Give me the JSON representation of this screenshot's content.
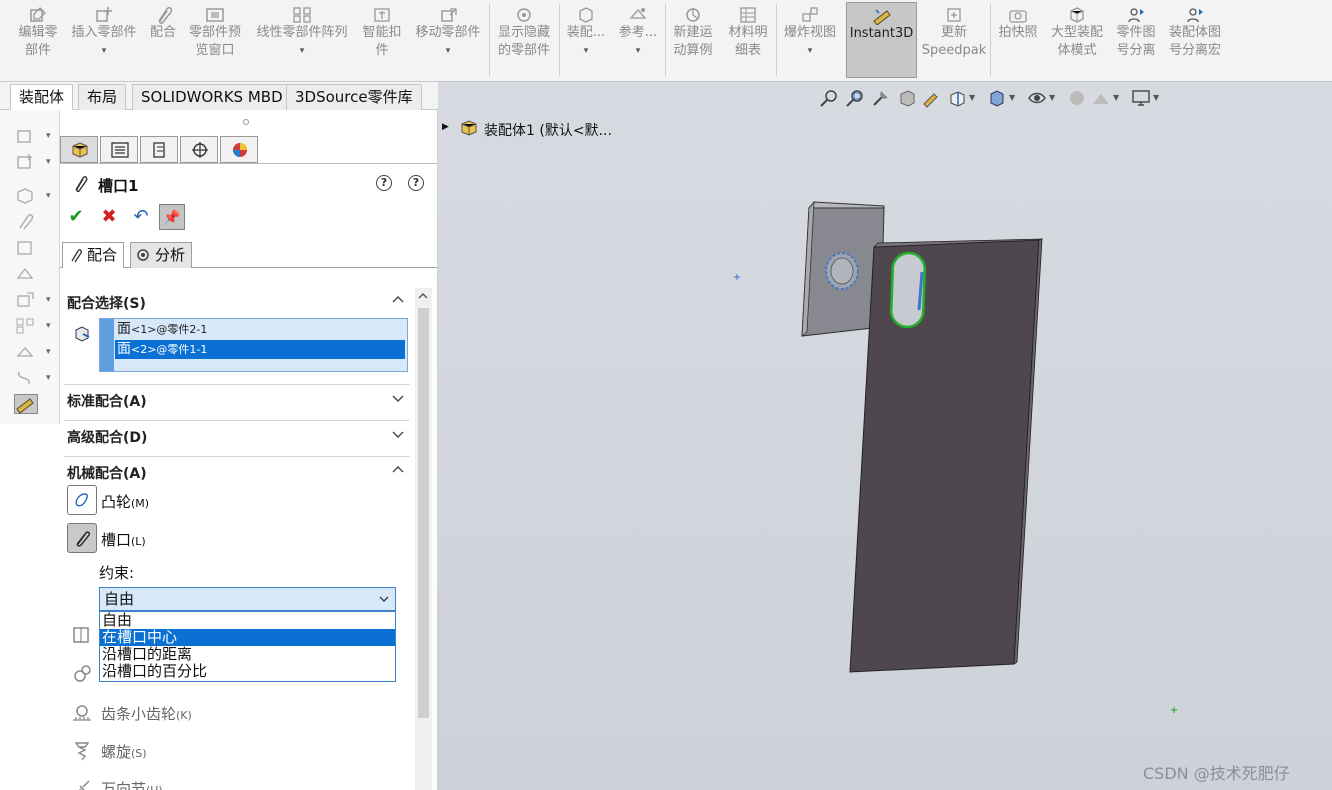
{
  "ribbon": {
    "buttons": [
      {
        "label": "编辑零\n部件",
        "icon": "edit-component-icon"
      },
      {
        "label": "插入零部件",
        "icon": "insert-component-icon"
      },
      {
        "label": "配合",
        "icon": "mate-icon"
      },
      {
        "label": "零部件预\n览窗口",
        "icon": "component-preview-icon"
      },
      {
        "label": "线性零部件阵列",
        "icon": "linear-pattern-icon"
      },
      {
        "label": "智能扣\n件",
        "icon": "smart-fasteners-icon"
      },
      {
        "label": "移动零部件",
        "icon": "move-component-icon"
      },
      {
        "label": "显示隐藏\n的零部件",
        "icon": "show-hidden-icon"
      },
      {
        "label": "装配...",
        "icon": "assembly-features-icon"
      },
      {
        "label": "参考...",
        "icon": "reference-geometry-icon"
      },
      {
        "label": "新建运\n动算例",
        "icon": "new-motion-study-icon"
      },
      {
        "label": "材料明\n细表",
        "icon": "bom-icon"
      },
      {
        "label": "爆炸视图",
        "icon": "exploded-view-icon"
      },
      {
        "label": "Instant3D",
        "icon": "instant3d-icon"
      },
      {
        "label": "更新\nSpeedpak",
        "icon": "update-speedpak-icon"
      },
      {
        "label": "拍快照",
        "icon": "snapshot-icon"
      },
      {
        "label": "大型装配\n体模式",
        "icon": "large-assembly-icon"
      },
      {
        "label": "零件图\n号分离",
        "icon": "part-number-split-icon"
      },
      {
        "label": "装配体图\n号分离宏",
        "icon": "assembly-number-split-icon"
      }
    ]
  },
  "tabs": [
    "装配体",
    "布局",
    "SOLIDWORKS MBD",
    "3DSource零件库"
  ],
  "pm": {
    "title": "槽口1",
    "subtabs": {
      "mates": "配合",
      "analysis": "分析"
    },
    "sections": {
      "selections": "配合选择(S)",
      "standard": "标准配合(A)",
      "advanced": "高级配合(D)",
      "mechanical": "机械配合(A)"
    },
    "selections": [
      {
        "main": "面",
        "sub": "<1>@零件2-1"
      },
      {
        "main": "面",
        "sub": "<2>@零件1-1"
      }
    ],
    "mech_mates": {
      "cam": {
        "label": "凸轮",
        "key": "(M)"
      },
      "slot": {
        "label": "槽口",
        "key": "(L)"
      },
      "rack": {
        "label": "齿条小齿轮",
        "key": "(K)"
      },
      "screw": {
        "label": "螺旋",
        "key": "(S)"
      },
      "universal": {
        "label": "万向节",
        "key": "(U)"
      }
    },
    "constraint_label": "约束:",
    "constraint_value": "自由",
    "constraint_options": [
      "自由",
      "在槽口中心",
      "沿槽口的距离",
      "沿槽口的百分比"
    ]
  },
  "viewport": {
    "tree_node": "装配体1  (默认<默..."
  },
  "watermark": "CSDN @技术死肥仔",
  "colors": {
    "selection_blue": "#0a70d4",
    "instant3d_active": "#c7c7c7",
    "ok_green": "#1a9a1a",
    "cancel_red": "#d42020",
    "viewport_bg": "#d3d7dd",
    "plate_dark": "#4f474e",
    "plate_light": "#8b8b90"
  }
}
